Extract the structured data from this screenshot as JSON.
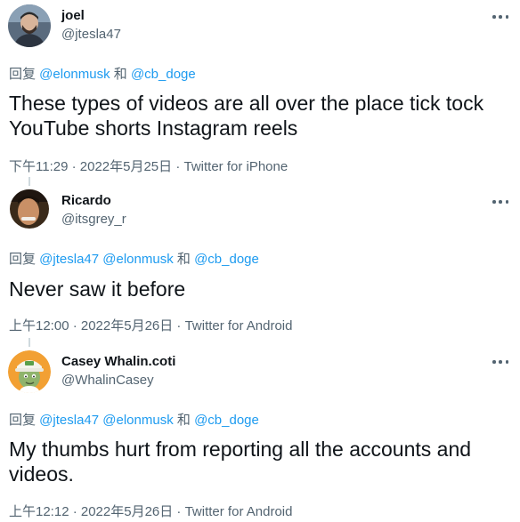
{
  "tweets": [
    {
      "name": "joel",
      "handle": "@jtesla47",
      "reply_prefix": "回复 ",
      "reply_to": [
        "@elonmusk",
        "@cb_doge"
      ],
      "reply_joiner": " 和 ",
      "text": "These types of videos are all over the place tick tock YouTube shorts Instagram reels",
      "meta": "下午11:29 · 2022年5月25日 · Twitter for iPhone",
      "avatar_icon": "person-avatar-icon"
    },
    {
      "name": "Ricardo",
      "handle": "@itsgrey_r",
      "reply_prefix": "回复 ",
      "reply_to": [
        "@jtesla47",
        "@elonmusk",
        "@cb_doge"
      ],
      "reply_joiner": " 和 ",
      "text": "Never saw it before",
      "meta": "上午12:00 · 2022年5月26日 · Twitter for Android",
      "avatar_icon": "person-avatar-icon"
    },
    {
      "name": "Casey Whalin.coti",
      "handle": "@WhalinCasey",
      "reply_prefix": "回复 ",
      "reply_to": [
        "@jtesla47",
        "@elonmusk",
        "@cb_doge"
      ],
      "reply_joiner": " 和 ",
      "text": "My thumbs hurt from reporting all the accounts and videos.",
      "meta": "上午12:12 · 2022年5月26日 · Twitter for Android",
      "avatar_icon": "cartoon-avatar-icon"
    }
  ],
  "colors": {
    "link": "#1d9bf0",
    "secondary_text": "#536471",
    "primary_text": "#0f1419",
    "thread_line": "#cfd9de"
  },
  "icons": {
    "more": "more-dots-icon"
  }
}
